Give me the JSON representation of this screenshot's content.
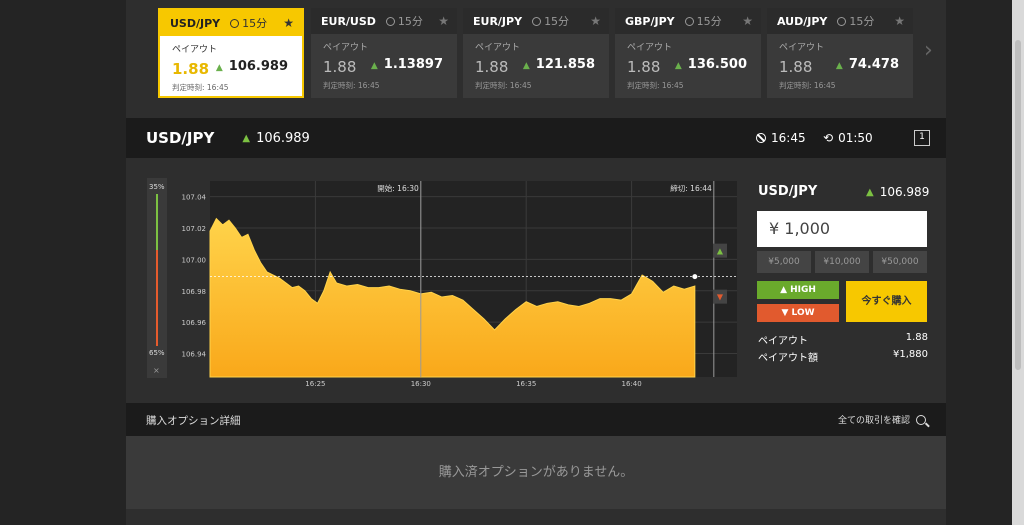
{
  "cards": [
    {
      "symbol": "USD/JPY",
      "duration": "15分",
      "payout_label": "ペイアウト",
      "payout": "1.88",
      "price": "106.989",
      "expiry": "判定時刻: 16:45",
      "active": true
    },
    {
      "symbol": "EUR/USD",
      "duration": "15分",
      "payout_label": "ペイアウト",
      "payout": "1.88",
      "price": "1.13897",
      "expiry": "判定時刻: 16:45",
      "active": false
    },
    {
      "symbol": "EUR/JPY",
      "duration": "15分",
      "payout_label": "ペイアウト",
      "payout": "1.88",
      "price": "121.858",
      "expiry": "判定時刻: 16:45",
      "active": false
    },
    {
      "symbol": "GBP/JPY",
      "duration": "15分",
      "payout_label": "ペイアウト",
      "payout": "1.88",
      "price": "136.500",
      "expiry": "判定時刻: 16:45",
      "active": false
    },
    {
      "symbol": "AUD/JPY",
      "duration": "15分",
      "payout_label": "ペイアウト",
      "payout": "1.88",
      "price": "74.478",
      "expiry": "判定時刻: 16:45",
      "active": false
    }
  ],
  "header": {
    "symbol": "USD/JPY",
    "price": "106.989",
    "expiry": "16:45",
    "countdown": "01:50",
    "chart_button": "1"
  },
  "sentiment": {
    "high_pct": "35%",
    "low_pct": "65%",
    "close": "×"
  },
  "chart_data": {
    "type": "area",
    "start_label": "開始: 16:30",
    "end_label": "締切: 16:44",
    "x_ticks": [
      "16:25",
      "16:30",
      "16:35",
      "16:40"
    ],
    "y_ticks": [
      "107.04",
      "107.02",
      "107.00",
      "106.98",
      "106.96",
      "106.94"
    ],
    "ylim": [
      106.925,
      107.05
    ],
    "xlim": [
      0,
      25
    ],
    "strike": 106.989,
    "x": [
      0,
      0.3,
      0.6,
      0.9,
      1.2,
      1.5,
      1.8,
      2.1,
      2.4,
      2.7,
      3.0,
      3.3,
      3.6,
      3.9,
      4.2,
      4.5,
      4.8,
      5.1,
      5.4,
      5.7,
      6.0,
      6.5,
      7.0,
      7.5,
      8.0,
      8.5,
      9.0,
      9.5,
      10.0,
      10.5,
      11.0,
      11.5,
      12.0,
      12.5,
      13.0,
      13.5,
      14.0,
      14.5,
      15.0,
      15.5,
      16.0,
      16.5,
      17.0,
      17.5,
      18.0,
      18.5,
      19.0,
      19.5,
      20.0,
      20.5,
      21.0,
      21.5,
      22.0,
      22.5,
      23.0
    ],
    "y": [
      107.018,
      107.026,
      107.022,
      107.025,
      107.02,
      107.014,
      107.016,
      107.006,
      106.998,
      106.992,
      106.99,
      106.988,
      106.985,
      106.982,
      106.983,
      106.98,
      106.975,
      106.972,
      106.98,
      106.992,
      106.985,
      106.983,
      106.984,
      106.982,
      106.982,
      106.983,
      106.981,
      106.98,
      106.978,
      106.979,
      106.976,
      106.977,
      106.974,
      106.968,
      106.962,
      106.955,
      106.962,
      106.968,
      106.973,
      106.97,
      106.972,
      106.973,
      106.971,
      106.97,
      106.972,
      106.975,
      106.975,
      106.974,
      106.978,
      106.99,
      106.986,
      106.979,
      106.983,
      106.981,
      106.983
    ],
    "y_end": 106.989
  },
  "trade": {
    "symbol": "USD/JPY",
    "price": "106.989",
    "amount": "¥ 1,000",
    "presets": [
      "¥5,000",
      "¥10,000",
      "¥50,000"
    ],
    "high": "HIGH",
    "low": "LOW",
    "buy": "今すぐ購入",
    "payout_label": "ペイアウト",
    "payout": "1.88",
    "payout_amount_label": "ペイアウト額",
    "payout_amount": "¥1,880"
  },
  "options": {
    "title": "購入オプション詳細",
    "link": "全ての取引を確認",
    "empty": "購入済オプションがありません。"
  },
  "colors": {
    "accent": "#f7c800",
    "up": "#7cc142",
    "down": "#e15a2e"
  }
}
